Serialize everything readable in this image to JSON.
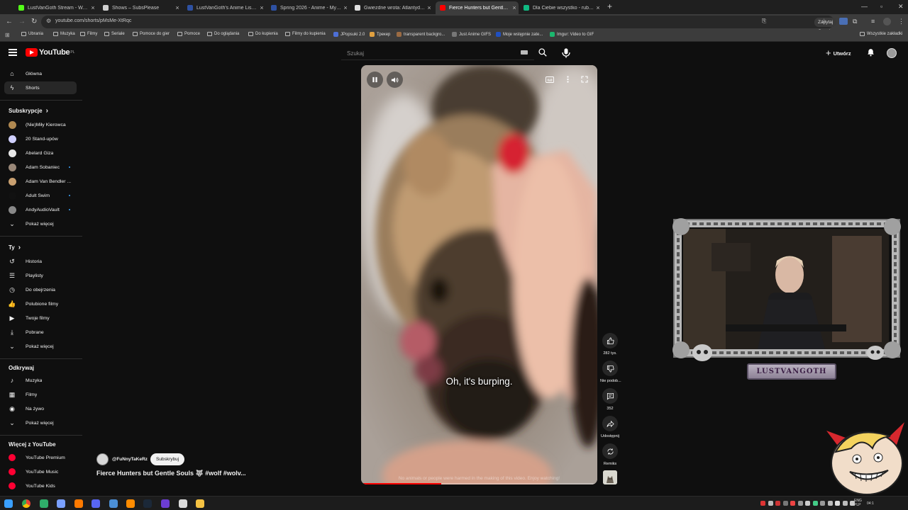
{
  "browser": {
    "tabs": [
      {
        "title": "LustVanGoth Stream - Watch Liv...",
        "color": "#53fc18"
      },
      {
        "title": "Shows – SubsPlease",
        "color": "#cfcfcf"
      },
      {
        "title": "LustVanGoth's Anime List - My...",
        "color": "#2e51a2"
      },
      {
        "title": "Spring 2026 - Anime - MyAnim...",
        "color": "#2e51a2"
      },
      {
        "title": "Gwiezdne wrota: Atlantyda / Sta...",
        "color": "#e0e0e0"
      },
      {
        "title": "Fierce Hunters but Gentle S...",
        "color": "#ff0000"
      },
      {
        "title": "Dla Ciebie wszystko - rubla - w...",
        "color": "#10b981"
      }
    ],
    "new_tab": "+",
    "url": "youtube.com/shorts/pMsMe-XtRqc",
    "ask_google": "Zapytaj Google",
    "bookmarks": [
      {
        "label": "Ubrania",
        "type": "folder"
      },
      {
        "label": "Muzyka",
        "type": "folder"
      },
      {
        "label": "Filmy",
        "type": "folder"
      },
      {
        "label": "Seriale",
        "type": "folder"
      },
      {
        "label": "Pomoce do gier",
        "type": "folder"
      },
      {
        "label": "Pomoce",
        "type": "folder"
      },
      {
        "label": "Do oglądania",
        "type": "folder"
      },
      {
        "label": "Do kupienia",
        "type": "folder"
      },
      {
        "label": "Filmy do kupienia",
        "type": "folder"
      },
      {
        "label": "JPopsuki 2.0",
        "type": "site",
        "color": "#4d6fd6"
      },
      {
        "label": "Трекер",
        "type": "site",
        "color": "#e0a040"
      },
      {
        "label": "transparent backgro...",
        "type": "site",
        "color": "#9b6b43"
      },
      {
        "label": "Just Anime GIFS",
        "type": "site",
        "color": "#777777"
      },
      {
        "label": "Moje wstępnie zate...",
        "type": "site",
        "color": "#2050c0"
      },
      {
        "label": "Imgur: Video to GIF",
        "type": "site",
        "color": "#1bb76e"
      }
    ],
    "all_bookmarks": "Wszystkie zakładki"
  },
  "youtube": {
    "logo_text": "YouTube",
    "country": "PL",
    "search_placeholder": "Szukaj",
    "create_label": "Utwórz",
    "sidebar": {
      "main": [
        {
          "label": "Główna",
          "icon": "home-icon"
        },
        {
          "label": "Shorts",
          "icon": "shorts-icon",
          "active": true
        }
      ],
      "subscriptions_title": "Subskrypcje",
      "subscriptions": [
        {
          "label": "(Nie)Miły Kierowca",
          "color": "#b08850",
          "dot": false
        },
        {
          "label": "20 Stand-upów",
          "color": "#d0d0ff",
          "dot": false
        },
        {
          "label": "Abelard Giza",
          "color": "#e8e8e8",
          "dot": false
        },
        {
          "label": "Adam Sobaniec",
          "color": "#9a8878",
          "dot": true
        },
        {
          "label": "Adam Van Bendler ...",
          "color": "#c9a070",
          "dot": false
        },
        {
          "label": "Adult Swim",
          "color": "#111111",
          "dot": true
        },
        {
          "label": "AndyAudioVault",
          "color": "#888888",
          "dot": true
        }
      ],
      "show_more_subs": "Pokaż więcej",
      "you_title": "Ty",
      "you": [
        {
          "label": "Historia",
          "icon": "history-icon"
        },
        {
          "label": "Playlisty",
          "icon": "playlist-icon"
        },
        {
          "label": "Do obejrzenia",
          "icon": "watch-later-icon"
        },
        {
          "label": "Polubione filmy",
          "icon": "like-icon"
        },
        {
          "label": "Twoje filmy",
          "icon": "your-videos-icon"
        },
        {
          "label": "Pobrane",
          "icon": "download-icon"
        }
      ],
      "show_more_you": "Pokaż więcej",
      "explore_title": "Odkrywaj",
      "explore": [
        {
          "label": "Muzyka",
          "icon": "music-icon"
        },
        {
          "label": "Filmy",
          "icon": "movies-icon"
        },
        {
          "label": "Na żywo",
          "icon": "live-icon"
        }
      ],
      "show_more_explore": "Pokaż więcej",
      "more_title": "Więcej z YouTube",
      "more": [
        {
          "label": "YouTube Premium"
        },
        {
          "label": "YouTube Music"
        },
        {
          "label": "YouTube Kids"
        }
      ]
    },
    "short": {
      "subtitle": "Oh, it's burping.",
      "disclaimer": "No animals or people were harmed in the making of this video. Enjoy watching!",
      "progress": 0.34,
      "channel": "@FuNnyTaKeRz",
      "subscribe_label": "Subskrybuj",
      "title": "Fierce Hunters but Gentle Souls 🐺 #wolf #wolv...",
      "actions": {
        "likes": "282 tys.",
        "dislike": "Nie podob...",
        "comments": "352",
        "share": "Udostępnij",
        "remix": "Remiks"
      }
    }
  },
  "stream_overlay": {
    "name_plate": "LUSTVANGOTH"
  },
  "taskbar": {
    "lang_1": "ENG",
    "lang_2": "PLP",
    "time": "04:1"
  }
}
